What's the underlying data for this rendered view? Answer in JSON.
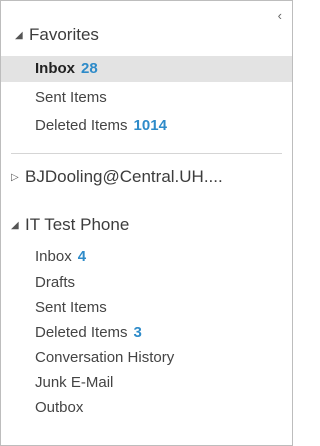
{
  "collapse_glyph": "‹",
  "favorites": {
    "label": "Favorites",
    "items": [
      {
        "label": "Inbox",
        "count": "28"
      },
      {
        "label": "Sent Items",
        "count": ""
      },
      {
        "label": "Deleted Items",
        "count": "1014"
      }
    ]
  },
  "account": {
    "label": "BJDooling@Central.UH...."
  },
  "it_test_phone": {
    "label": "IT Test Phone",
    "items": [
      {
        "label": "Inbox",
        "count": "4"
      },
      {
        "label": "Drafts",
        "count": ""
      },
      {
        "label": "Sent Items",
        "count": ""
      },
      {
        "label": "Deleted Items",
        "count": "3"
      },
      {
        "label": "Conversation History",
        "count": ""
      },
      {
        "label": "Junk E-Mail",
        "count": ""
      },
      {
        "label": "Outbox",
        "count": ""
      }
    ]
  },
  "colors": {
    "count_blue": "#2e8bc9",
    "selected_bg": "#e3e3e3"
  }
}
